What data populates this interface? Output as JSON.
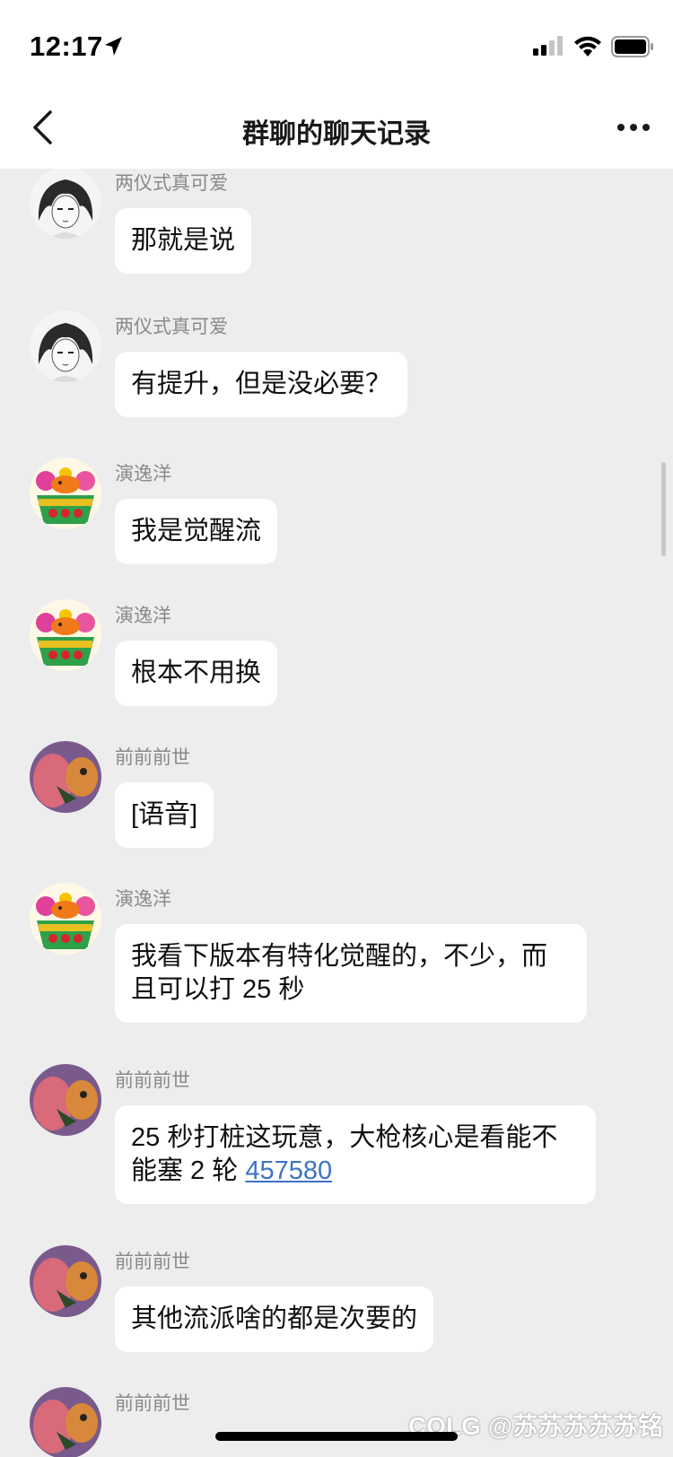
{
  "status_bar": {
    "time": "12:17",
    "icons": [
      "location-arrow-icon",
      "signal-icon",
      "wifi-icon",
      "battery-icon"
    ]
  },
  "nav": {
    "title": "群聊的聊天记录",
    "back_icon": "chevron-left-icon",
    "more_icon": "ellipsis-icon"
  },
  "messages": [
    {
      "sender": "两仪式真可爱",
      "avatar": "anime-girl-avatar",
      "text": "那就是说"
    },
    {
      "sender": "两仪式真可爱",
      "avatar": "anime-girl-avatar",
      "text": "有提升，但是没必要？"
    },
    {
      "sender": "演逸洋",
      "avatar": "koi-flower-basket-avatar",
      "text": "我是觉醒流"
    },
    {
      "sender": "演逸洋",
      "avatar": "koi-flower-basket-avatar",
      "text": "根本不用换"
    },
    {
      "sender": "前前前世",
      "avatar": "cartoon-avatar",
      "text": "[语音]"
    },
    {
      "sender": "演逸洋",
      "avatar": "koi-flower-basket-avatar",
      "text_line1": "我看下版本有特化觉醒的，不少，而",
      "text_line2": "且可以打 25 秒"
    },
    {
      "sender": "前前前世",
      "avatar": "cartoon-avatar",
      "text_line1": "25 秒打桩这玩意，大枪核心是看能不",
      "text_line2_prefix": "能塞 2 轮 ",
      "link": "457580"
    },
    {
      "sender": "前前前世",
      "avatar": "cartoon-avatar",
      "text": "其他流派啥的都是次要的"
    },
    {
      "sender": "前前前世",
      "avatar": "cartoon-avatar"
    }
  ],
  "watermark": "COLG @苏苏苏苏苏铭",
  "colors": {
    "background": "#ededed",
    "bubble": "#ffffff",
    "link": "#3d72c4",
    "sender_name": "#8a8a8a"
  }
}
